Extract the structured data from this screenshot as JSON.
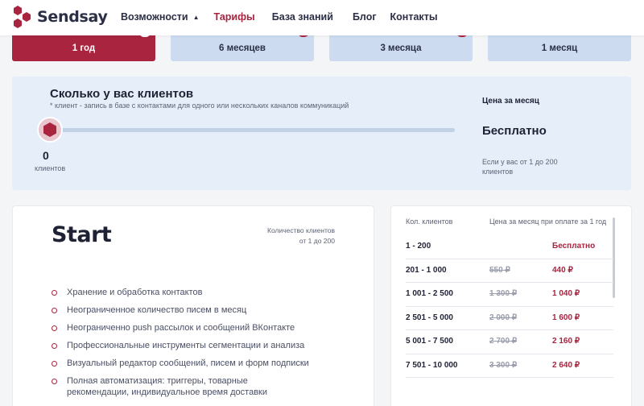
{
  "header": {
    "brand": "Sendsay",
    "nav": [
      {
        "label": "Возможности",
        "active": false,
        "dropdown": true
      },
      {
        "label": "Тарифы",
        "active": true,
        "dropdown": false
      },
      {
        "label": "База знаний",
        "active": false,
        "dropdown": false
      },
      {
        "label": "Блог",
        "active": false,
        "dropdown": false
      },
      {
        "label": "Контакты",
        "active": false,
        "dropdown": false
      }
    ],
    "chevron_icon": "chevron-up-icon"
  },
  "periods": [
    {
      "label": "1 год",
      "selected": true
    },
    {
      "label": "6 месяцев",
      "selected": false
    },
    {
      "label": "3 месяца",
      "selected": false
    },
    {
      "label": "1 месяц",
      "selected": false
    }
  ],
  "clients": {
    "title": "Сколько у вас клиентов",
    "note": "* клиент - запись в базе с контактами для одного или нескольких каналов коммуникаций",
    "slider_value": "0",
    "slider_unit": "клиентов",
    "slider_level": 0,
    "price_label": "Цена за месяц",
    "price_value": "Бесплатно",
    "price_note": "Если у вас от 1 до 200 клиентов"
  },
  "plan": {
    "name": "Start",
    "qty_label": "Количество клиентов",
    "qty_range": "от 1 до 200",
    "features": [
      "Хранение и обработка контактов",
      "Неограниченное количество писем в месяц",
      "Неограниченно push рассылок и сообщений ВКонтакте",
      "Профессиональные инструменты сегментации и анализа",
      "Визуальный редактор сообщений, писем и форм подписки",
      "Полная автоматизация: триггеры, товарные рекомендации, индивидуальное время доставки"
    ]
  },
  "price_table": {
    "col_clients": "Кол. клиентов",
    "col_price": "Цена за месяц при оплате за 1 год",
    "rows": [
      {
        "range": "1 - 200",
        "old": "",
        "new": "Бесплатно"
      },
      {
        "range": "201 - 1 000",
        "old": "550 ₽",
        "new": "440 ₽"
      },
      {
        "range": "1 001 - 2 500",
        "old": "1 300 ₽",
        "new": "1 040 ₽"
      },
      {
        "range": "2 501 - 5 000",
        "old": "2 000 ₽",
        "new": "1 600 ₽"
      },
      {
        "range": "5 001 - 7 500",
        "old": "2 700 ₽",
        "new": "2 160 ₽"
      },
      {
        "range": "7 501 - 10 000",
        "old": "3 300 ₽",
        "new": "2 640 ₽"
      }
    ]
  },
  "colors": {
    "accent": "#a8243f",
    "panel": "#e6eefa",
    "period_inactive": "#ccdbf0",
    "text": "#1f2235"
  }
}
